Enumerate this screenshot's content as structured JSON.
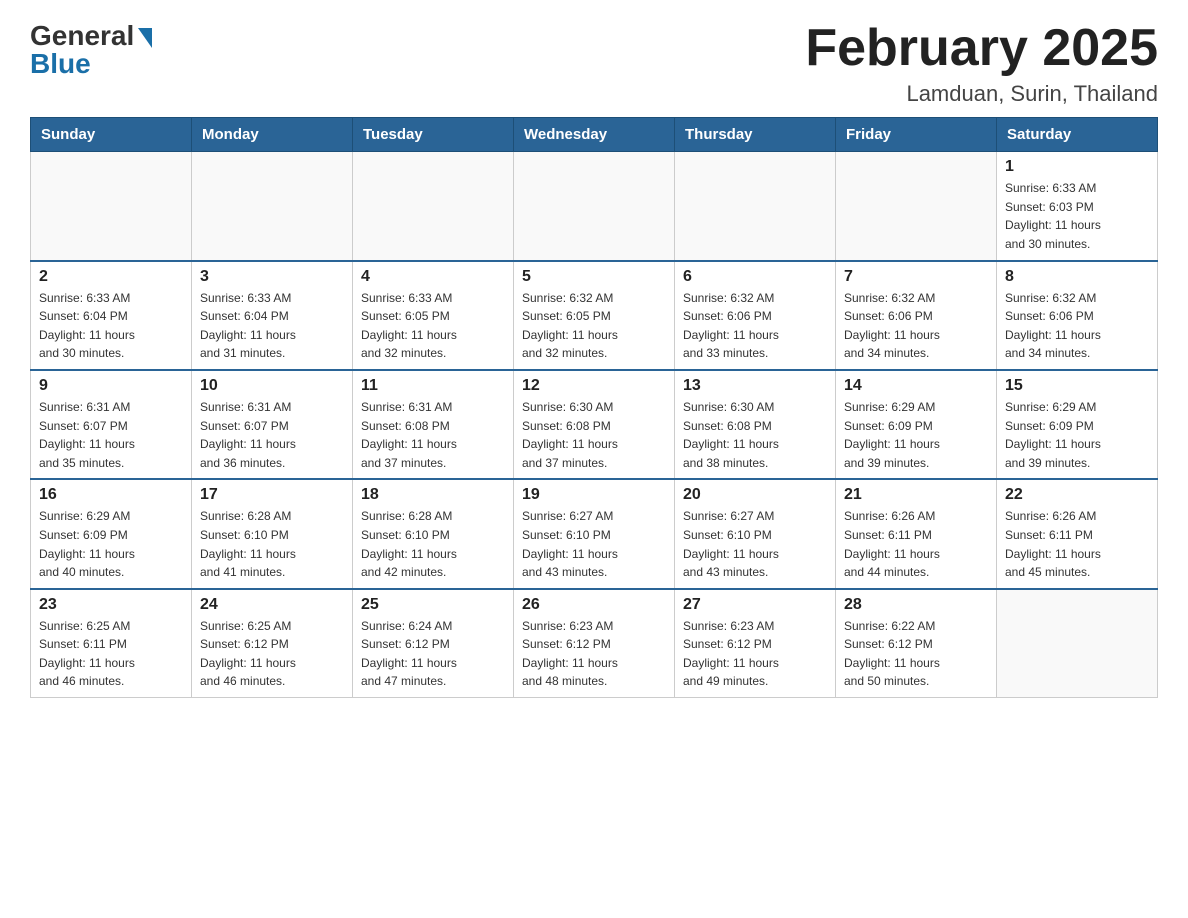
{
  "header": {
    "logo_general": "General",
    "logo_blue": "Blue",
    "title": "February 2025",
    "subtitle": "Lamduan, Surin, Thailand"
  },
  "weekdays": [
    "Sunday",
    "Monday",
    "Tuesday",
    "Wednesday",
    "Thursday",
    "Friday",
    "Saturday"
  ],
  "weeks": [
    [
      {
        "day": "",
        "info": ""
      },
      {
        "day": "",
        "info": ""
      },
      {
        "day": "",
        "info": ""
      },
      {
        "day": "",
        "info": ""
      },
      {
        "day": "",
        "info": ""
      },
      {
        "day": "",
        "info": ""
      },
      {
        "day": "1",
        "info": "Sunrise: 6:33 AM\nSunset: 6:03 PM\nDaylight: 11 hours\nand 30 minutes."
      }
    ],
    [
      {
        "day": "2",
        "info": "Sunrise: 6:33 AM\nSunset: 6:04 PM\nDaylight: 11 hours\nand 30 minutes."
      },
      {
        "day": "3",
        "info": "Sunrise: 6:33 AM\nSunset: 6:04 PM\nDaylight: 11 hours\nand 31 minutes."
      },
      {
        "day": "4",
        "info": "Sunrise: 6:33 AM\nSunset: 6:05 PM\nDaylight: 11 hours\nand 32 minutes."
      },
      {
        "day": "5",
        "info": "Sunrise: 6:32 AM\nSunset: 6:05 PM\nDaylight: 11 hours\nand 32 minutes."
      },
      {
        "day": "6",
        "info": "Sunrise: 6:32 AM\nSunset: 6:06 PM\nDaylight: 11 hours\nand 33 minutes."
      },
      {
        "day": "7",
        "info": "Sunrise: 6:32 AM\nSunset: 6:06 PM\nDaylight: 11 hours\nand 34 minutes."
      },
      {
        "day": "8",
        "info": "Sunrise: 6:32 AM\nSunset: 6:06 PM\nDaylight: 11 hours\nand 34 minutes."
      }
    ],
    [
      {
        "day": "9",
        "info": "Sunrise: 6:31 AM\nSunset: 6:07 PM\nDaylight: 11 hours\nand 35 minutes."
      },
      {
        "day": "10",
        "info": "Sunrise: 6:31 AM\nSunset: 6:07 PM\nDaylight: 11 hours\nand 36 minutes."
      },
      {
        "day": "11",
        "info": "Sunrise: 6:31 AM\nSunset: 6:08 PM\nDaylight: 11 hours\nand 37 minutes."
      },
      {
        "day": "12",
        "info": "Sunrise: 6:30 AM\nSunset: 6:08 PM\nDaylight: 11 hours\nand 37 minutes."
      },
      {
        "day": "13",
        "info": "Sunrise: 6:30 AM\nSunset: 6:08 PM\nDaylight: 11 hours\nand 38 minutes."
      },
      {
        "day": "14",
        "info": "Sunrise: 6:29 AM\nSunset: 6:09 PM\nDaylight: 11 hours\nand 39 minutes."
      },
      {
        "day": "15",
        "info": "Sunrise: 6:29 AM\nSunset: 6:09 PM\nDaylight: 11 hours\nand 39 minutes."
      }
    ],
    [
      {
        "day": "16",
        "info": "Sunrise: 6:29 AM\nSunset: 6:09 PM\nDaylight: 11 hours\nand 40 minutes."
      },
      {
        "day": "17",
        "info": "Sunrise: 6:28 AM\nSunset: 6:10 PM\nDaylight: 11 hours\nand 41 minutes."
      },
      {
        "day": "18",
        "info": "Sunrise: 6:28 AM\nSunset: 6:10 PM\nDaylight: 11 hours\nand 42 minutes."
      },
      {
        "day": "19",
        "info": "Sunrise: 6:27 AM\nSunset: 6:10 PM\nDaylight: 11 hours\nand 43 minutes."
      },
      {
        "day": "20",
        "info": "Sunrise: 6:27 AM\nSunset: 6:10 PM\nDaylight: 11 hours\nand 43 minutes."
      },
      {
        "day": "21",
        "info": "Sunrise: 6:26 AM\nSunset: 6:11 PM\nDaylight: 11 hours\nand 44 minutes."
      },
      {
        "day": "22",
        "info": "Sunrise: 6:26 AM\nSunset: 6:11 PM\nDaylight: 11 hours\nand 45 minutes."
      }
    ],
    [
      {
        "day": "23",
        "info": "Sunrise: 6:25 AM\nSunset: 6:11 PM\nDaylight: 11 hours\nand 46 minutes."
      },
      {
        "day": "24",
        "info": "Sunrise: 6:25 AM\nSunset: 6:12 PM\nDaylight: 11 hours\nand 46 minutes."
      },
      {
        "day": "25",
        "info": "Sunrise: 6:24 AM\nSunset: 6:12 PM\nDaylight: 11 hours\nand 47 minutes."
      },
      {
        "day": "26",
        "info": "Sunrise: 6:23 AM\nSunset: 6:12 PM\nDaylight: 11 hours\nand 48 minutes."
      },
      {
        "day": "27",
        "info": "Sunrise: 6:23 AM\nSunset: 6:12 PM\nDaylight: 11 hours\nand 49 minutes."
      },
      {
        "day": "28",
        "info": "Sunrise: 6:22 AM\nSunset: 6:12 PM\nDaylight: 11 hours\nand 50 minutes."
      },
      {
        "day": "",
        "info": ""
      }
    ]
  ]
}
